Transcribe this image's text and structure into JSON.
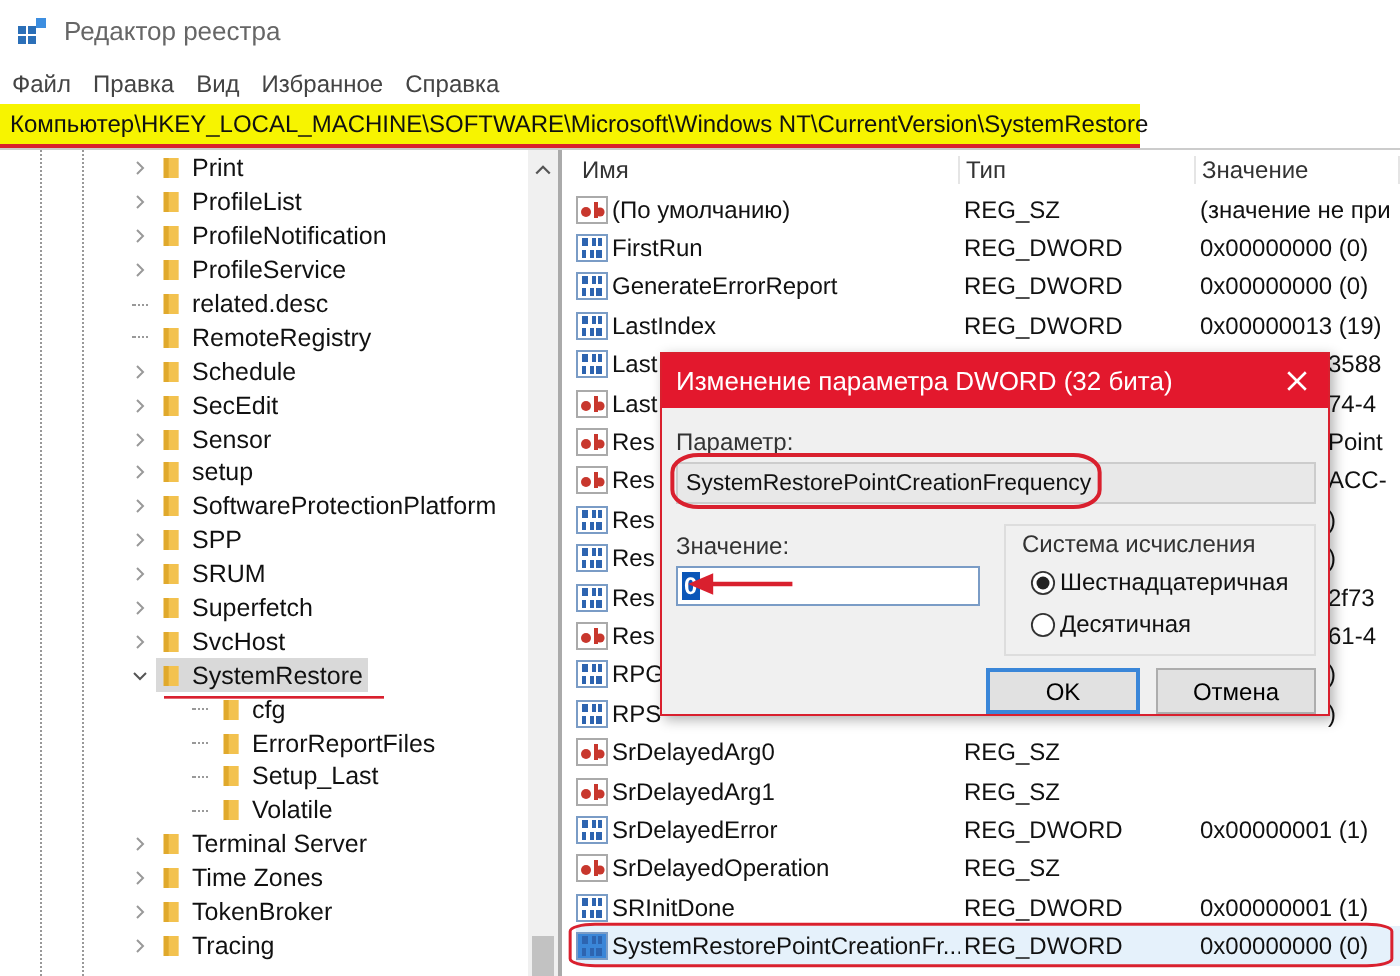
{
  "window": {
    "title": "Редактор реестра"
  },
  "menu": [
    "Файл",
    "Правка",
    "Вид",
    "Избранное",
    "Справка"
  ],
  "address": "Компьютер\\HKEY_LOCAL_MACHINE\\SOFTWARE\\Microsoft\\Windows NT\\CurrentVersion\\SystemRestore",
  "tree": [
    {
      "label": "Print",
      "expandable": true,
      "expanded": false,
      "selected": false
    },
    {
      "label": "ProfileList",
      "expandable": true,
      "expanded": false,
      "selected": false
    },
    {
      "label": "ProfileNotification",
      "expandable": true,
      "expanded": false,
      "selected": false
    },
    {
      "label": "ProfileService",
      "expandable": true,
      "expanded": false,
      "selected": false
    },
    {
      "label": "related.desc",
      "expandable": false,
      "expanded": false,
      "selected": false
    },
    {
      "label": "RemoteRegistry",
      "expandable": false,
      "expanded": false,
      "selected": false
    },
    {
      "label": "Schedule",
      "expandable": true,
      "expanded": false,
      "selected": false
    },
    {
      "label": "SecEdit",
      "expandable": true,
      "expanded": false,
      "selected": false
    },
    {
      "label": "Sensor",
      "expandable": true,
      "expanded": false,
      "selected": false
    },
    {
      "label": "setup",
      "expandable": true,
      "expanded": false,
      "selected": false
    },
    {
      "label": "SoftwareProtectionPlatform",
      "expandable": true,
      "expanded": false,
      "selected": false
    },
    {
      "label": "SPP",
      "expandable": true,
      "expanded": false,
      "selected": false
    },
    {
      "label": "SRUM",
      "expandable": true,
      "expanded": false,
      "selected": false
    },
    {
      "label": "Superfetch",
      "expandable": true,
      "expanded": false,
      "selected": false
    },
    {
      "label": "SvcHost",
      "expandable": true,
      "expanded": false,
      "selected": false
    },
    {
      "label": "SystemRestore",
      "expandable": true,
      "expanded": true,
      "selected": true,
      "children": [
        {
          "label": "cfg",
          "expandable": false,
          "expanded": false,
          "selected": false
        },
        {
          "label": "ErrorReportFiles",
          "expandable": false,
          "expanded": false,
          "selected": false
        },
        {
          "label": "Setup_Last",
          "expandable": false,
          "expanded": false,
          "selected": false
        },
        {
          "label": "Volatile",
          "expandable": false,
          "expanded": false,
          "selected": false
        }
      ]
    },
    {
      "label": "Terminal Server",
      "expandable": true,
      "expanded": false,
      "selected": false
    },
    {
      "label": "Time Zones",
      "expandable": true,
      "expanded": false,
      "selected": false
    },
    {
      "label": "TokenBroker",
      "expandable": true,
      "expanded": false,
      "selected": false
    },
    {
      "label": "Tracing",
      "expandable": true,
      "expanded": false,
      "selected": false
    }
  ],
  "list": {
    "columns": [
      "Имя",
      "Тип",
      "Значение"
    ],
    "rows": [
      {
        "kind": "string",
        "name": "(По умолчанию)",
        "type": "REG_SZ",
        "value": "(значение не при",
        "selected": false
      },
      {
        "kind": "dword",
        "name": "FirstRun",
        "type": "REG_DWORD",
        "value": "0x00000000 (0)",
        "selected": false
      },
      {
        "kind": "dword",
        "name": "GenerateErrorReport",
        "type": "REG_DWORD",
        "value": "0x00000000 (0)",
        "selected": false
      },
      {
        "kind": "dword",
        "name": "LastIndex",
        "type": "REG_DWORD",
        "value": "0x00000013 (19)",
        "selected": false
      },
      {
        "kind": "dword",
        "name": "Last",
        "value": "3588",
        "covered": true,
        "selected": false
      },
      {
        "kind": "string",
        "name": "Last",
        "value": "74-4",
        "covered": true,
        "selected": false
      },
      {
        "kind": "string",
        "name": "Res",
        "value": "Point",
        "covered": true,
        "selected": false
      },
      {
        "kind": "string",
        "name": "Res",
        "value": "ACC-",
        "covered": true,
        "selected": false
      },
      {
        "kind": "dword",
        "name": "Res",
        "value": ")",
        "covered": true,
        "selected": false
      },
      {
        "kind": "dword",
        "name": "Res",
        "value": ")",
        "covered": true,
        "selected": false
      },
      {
        "kind": "dword",
        "name": "Res",
        "value": "2f73",
        "covered": true,
        "selected": false
      },
      {
        "kind": "string",
        "name": "Res",
        "value": "61-4",
        "covered": true,
        "selected": false
      },
      {
        "kind": "dword",
        "name": "RPG",
        "value": ")",
        "covered": true,
        "selected": false
      },
      {
        "kind": "dword",
        "name": "RPS",
        "value": ")",
        "covered": true,
        "selected": false
      },
      {
        "kind": "string",
        "name": "SrDelayedArg0",
        "type": "REG_SZ",
        "selected": false
      },
      {
        "kind": "string",
        "name": "SrDelayedArg1",
        "type": "REG_SZ",
        "selected": false
      },
      {
        "kind": "dword",
        "name": "SrDelayedError",
        "type": "REG_DWORD",
        "value": "0x00000001 (1)",
        "selected": false
      },
      {
        "kind": "string",
        "name": "SrDelayedOperation",
        "type": "REG_SZ",
        "selected": false
      },
      {
        "kind": "dword",
        "name": "SRInitDone",
        "type": "REG_DWORD",
        "value": "0x00000001 (1)",
        "selected": false
      },
      {
        "kind": "dword",
        "name": "SystemRestorePointCreationFr...",
        "type": "REG_DWORD",
        "value": "0x00000000 (0)",
        "selected": true
      }
    ]
  },
  "dialog": {
    "title": "Изменение параметра DWORD (32 бита)",
    "param_label": "Параметр:",
    "param_value": "SystemRestorePointCreationFrequency",
    "value_label": "Значение:",
    "value": "0",
    "base_label": "Система исчисления",
    "radios": [
      {
        "label": "Шестнадцатеричная",
        "selected": true
      },
      {
        "label": "Десятичная",
        "selected": false
      }
    ],
    "buttons": [
      {
        "label": "OK",
        "default": true
      },
      {
        "label": "Отмена",
        "default": false
      }
    ]
  }
}
